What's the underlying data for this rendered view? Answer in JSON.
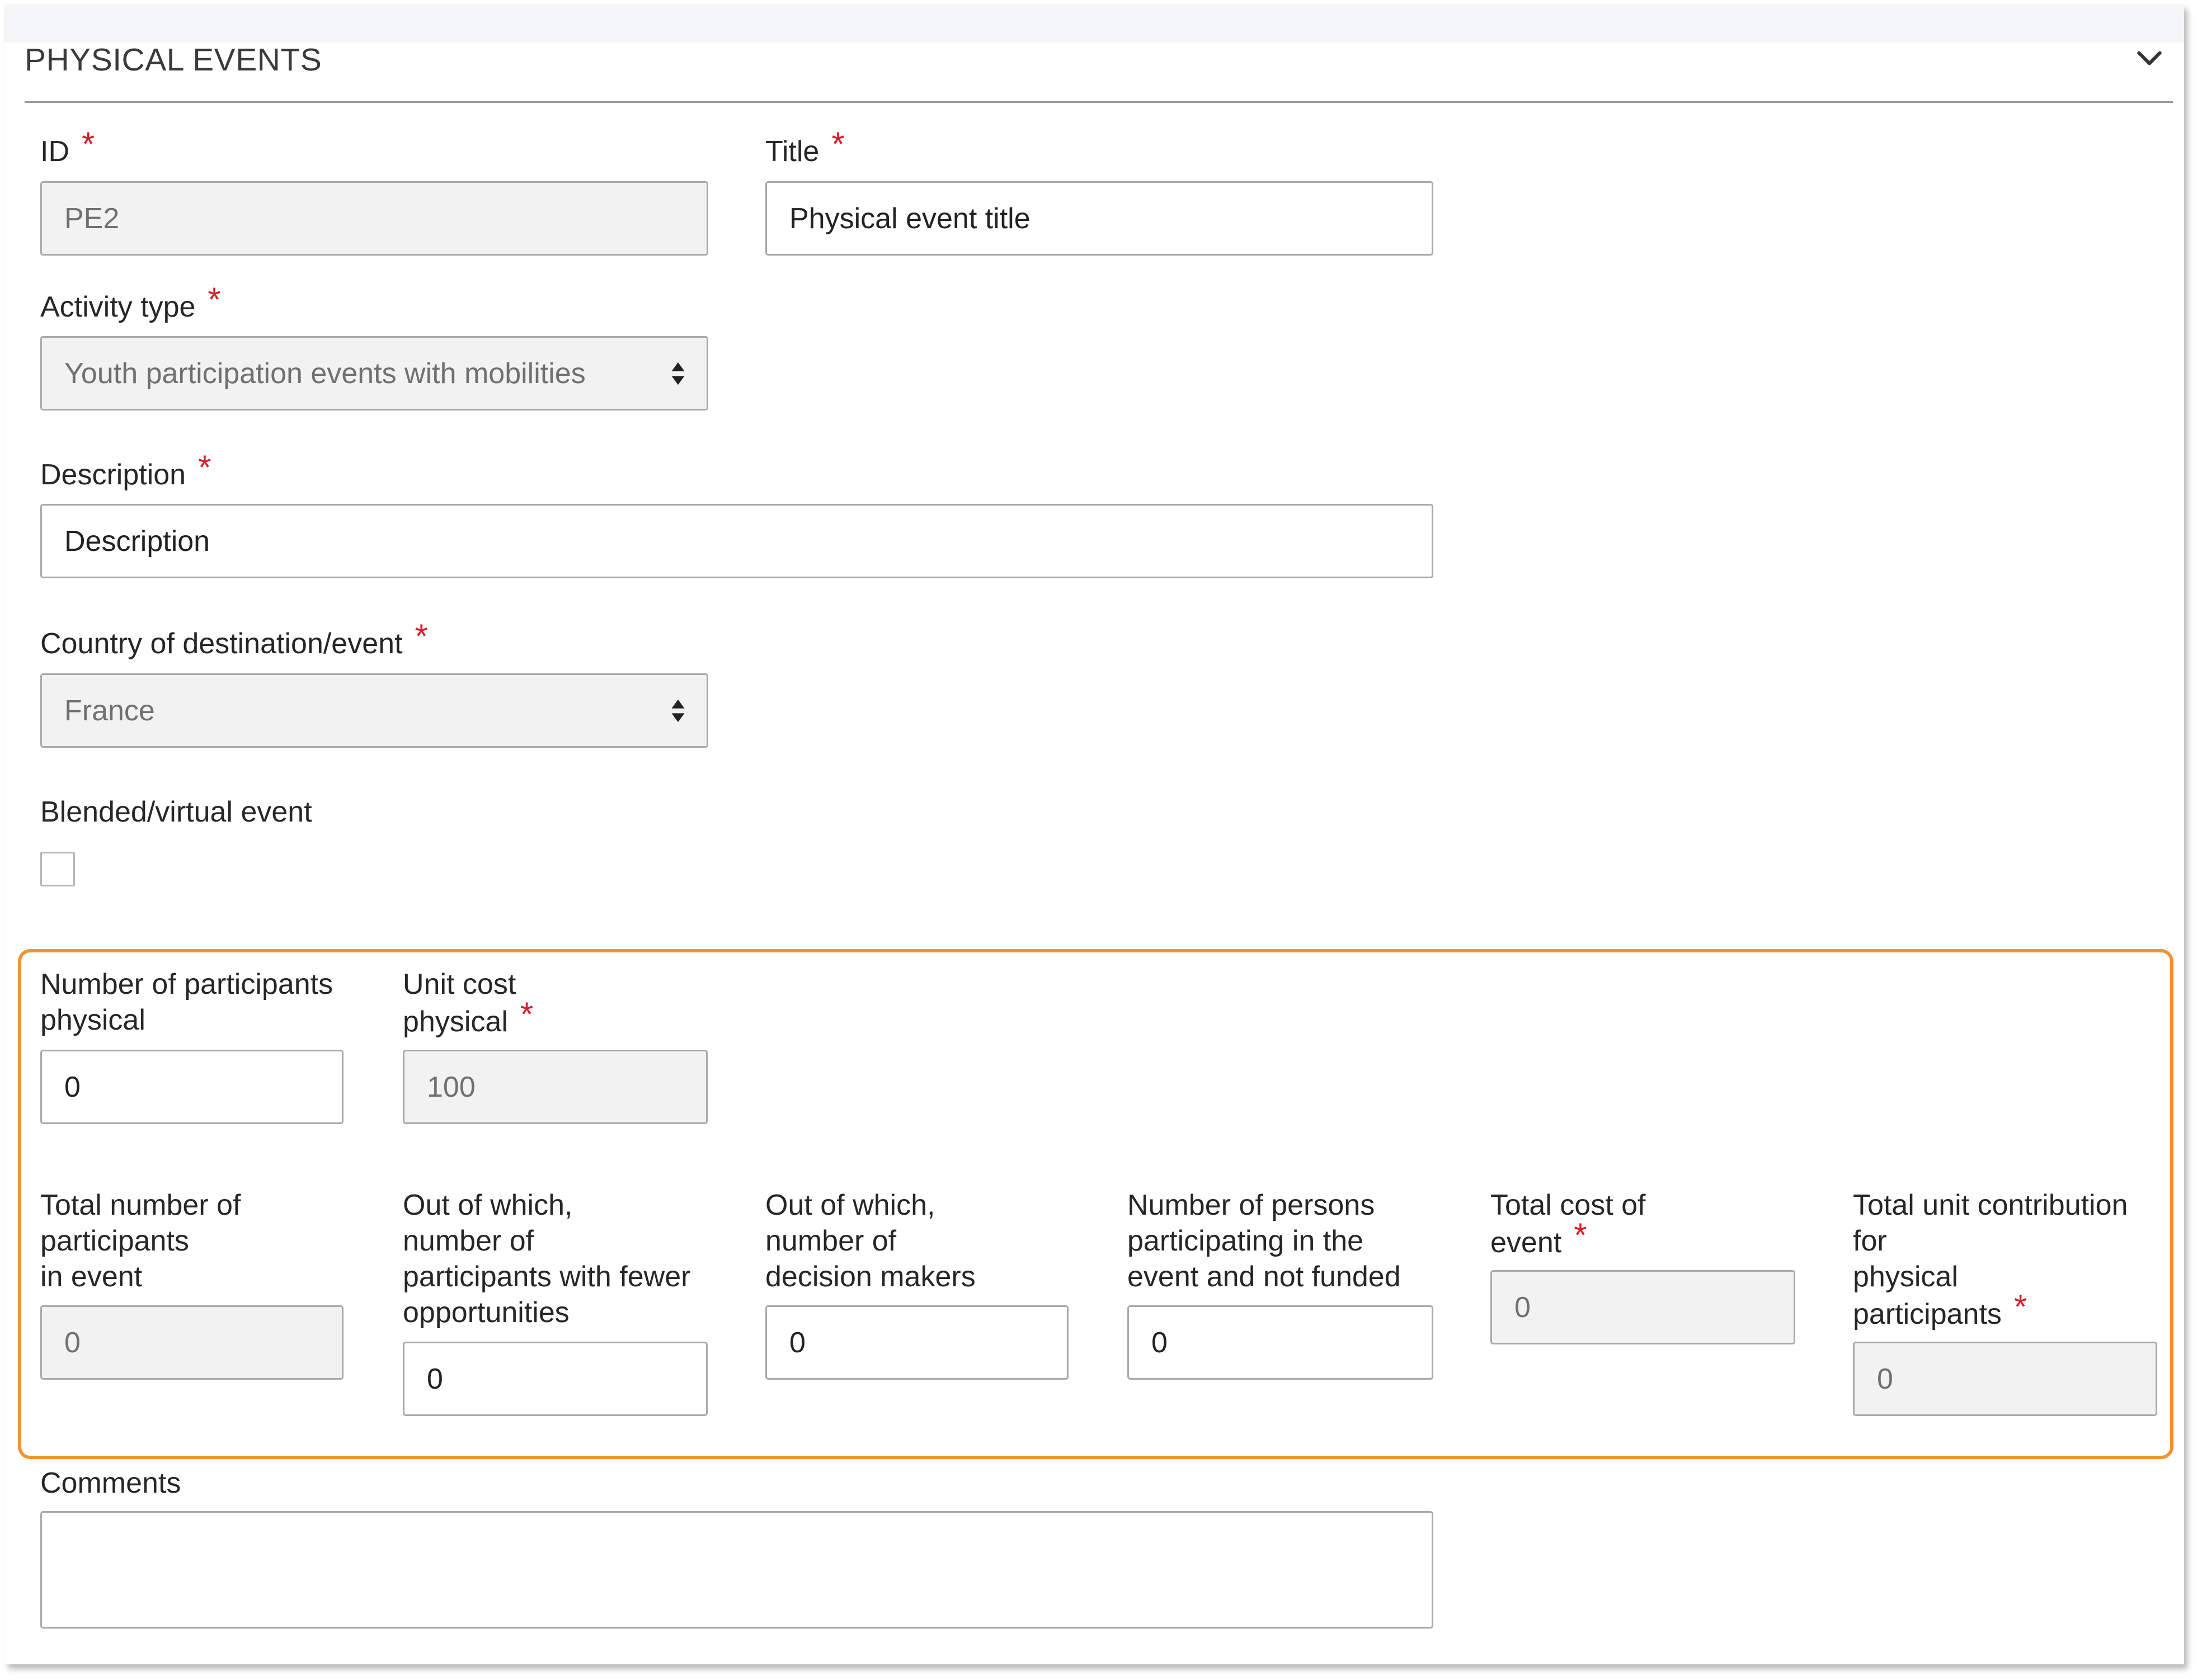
{
  "section": {
    "title": "PHYSICAL EVENTS",
    "collapse_icon": "chevron-down-icon"
  },
  "fields": {
    "id": {
      "label": "ID",
      "value": "PE2"
    },
    "title": {
      "label": "Title",
      "value": "Physical event title"
    },
    "activity_type": {
      "label": "Activity type",
      "value": "Youth participation events with mobilities"
    },
    "description": {
      "label": "Description",
      "value": "Description"
    },
    "country": {
      "label": "Country of destination/event",
      "value": "France"
    },
    "blended": {
      "label": "Blended/virtual event",
      "checked": false
    },
    "participants_physical": {
      "label_line1": "Number of participants",
      "label_line2": "physical",
      "value": "0"
    },
    "unit_cost_physical": {
      "label_line1": "Unit cost",
      "label_line2": "physical",
      "value": "100"
    },
    "total_participants": {
      "label_line1": "Total number of",
      "label_line2": "participants",
      "label_line3": "in event",
      "value": "0"
    },
    "fewer_opportunities": {
      "label_line1": "Out of which,",
      "label_line2": "number of",
      "label_line3": "participants with fewer",
      "label_line4": "opportunities",
      "value": "0"
    },
    "decision_makers": {
      "label_line1": "Out of which,",
      "label_line2": "number of",
      "label_line3": "decision makers",
      "value": "0"
    },
    "not_funded": {
      "label_line1": "Number of persons",
      "label_line2": "participating in the",
      "label_line3": "event and not funded",
      "value": "0"
    },
    "total_cost": {
      "label_line1": "Total cost of",
      "label_line2": "event",
      "value": "0"
    },
    "total_contribution": {
      "label_line1": "Total unit contribution",
      "label_line2": "for",
      "label_line3": "physical",
      "label_line4": "participants",
      "value": "0"
    },
    "comments": {
      "label": "Comments",
      "value": ""
    }
  },
  "required_marker": "*",
  "colors": {
    "required": "#d3202b",
    "highlight_border": "#f0942f",
    "disabled_bg": "#f2f2f2",
    "field_border": "#a9a9a9"
  }
}
